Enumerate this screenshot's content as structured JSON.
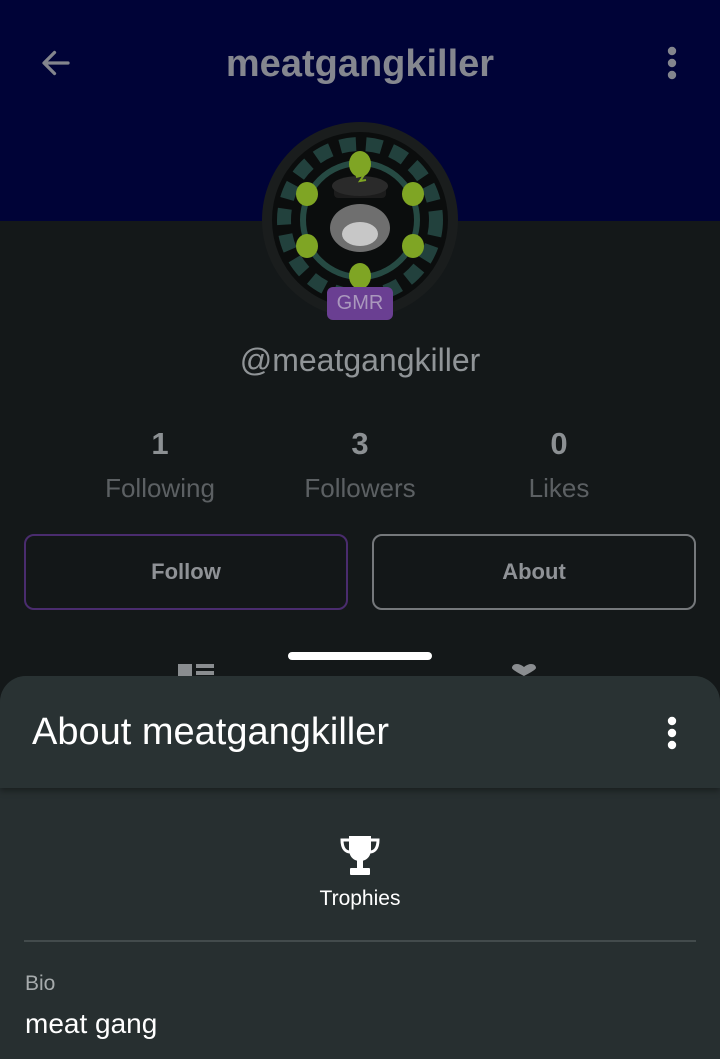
{
  "header": {
    "title": "meatgangkiller",
    "back_icon": "arrow-left-icon",
    "menu_icon": "more-vertical-icon"
  },
  "profile": {
    "badge": "GMR",
    "handle": "@meatgangkiller"
  },
  "stats": [
    {
      "value": "1",
      "label": "Following"
    },
    {
      "value": "3",
      "label": "Followers"
    },
    {
      "value": "0",
      "label": "Likes"
    }
  ],
  "buttons": {
    "follow": "Follow",
    "about": "About"
  },
  "sheet": {
    "title": "About meatgangkiller",
    "trophies_label": "Trophies",
    "bio_label": "Bio",
    "bio_value": "meat gang"
  },
  "colors": {
    "header_bg": "#000337",
    "page_bg": "#141819",
    "sheet_bg": "#272f30",
    "badge": "#6a3f92",
    "avatar_green": "#7fa524"
  }
}
